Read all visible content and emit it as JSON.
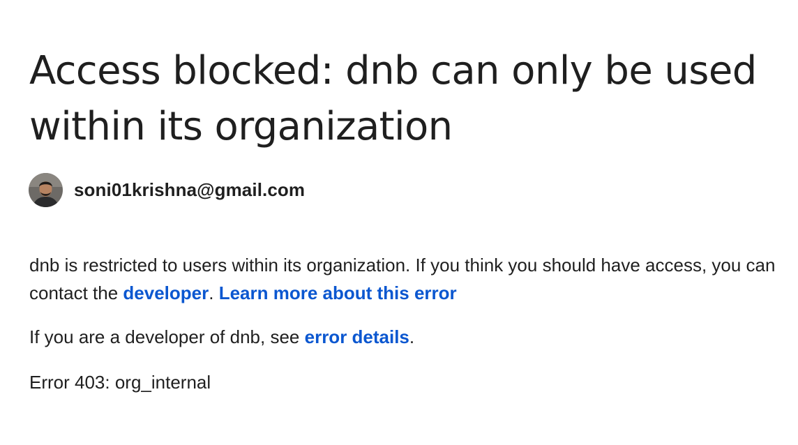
{
  "page": {
    "title": "Access blocked: dnb can only be used within its organization"
  },
  "account": {
    "email": "soni01krishna@gmail.com"
  },
  "message": {
    "restriction_text": "dnb is restricted to users within its organization. If you think you should have access, you can contact the ",
    "developer_link": "developer",
    "sentence_end": ". ",
    "learn_more_link": "Learn more about this error",
    "developer_prefix": "If you are a developer of dnb, see ",
    "error_details_link": "error details",
    "developer_suffix": ".",
    "error_code": "Error 403: org_internal"
  },
  "colors": {
    "link": "#0b57d0",
    "text": "#1f1f1f",
    "background": "#ffffff"
  }
}
